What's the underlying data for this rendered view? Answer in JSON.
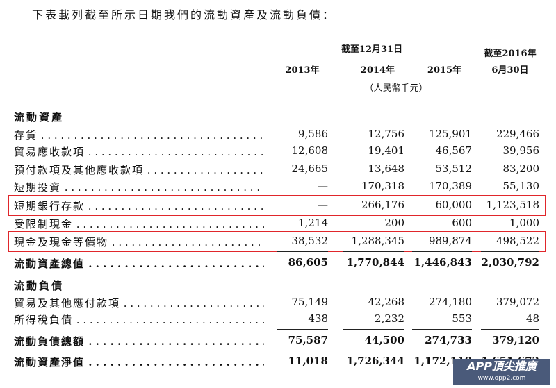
{
  "intro": "下表載列截至所示日期我們的流動資產及流動負債：",
  "headers": {
    "span_label": "截至12月31日",
    "y2013": "2013年",
    "y2014": "2014年",
    "y2015": "2015年",
    "last_line1": "截至2016年",
    "last_line2": "6月30日",
    "unit": "（人民幣千元）"
  },
  "sections": {
    "assets": "流動資產",
    "liabilities": "流動負債"
  },
  "rows": [
    {
      "label": "存貨",
      "v": [
        "9,586",
        "12,756",
        "125,901",
        "229,466"
      ]
    },
    {
      "label": "貿易應收款項",
      "v": [
        "12,608",
        "19,401",
        "46,567",
        "39,956"
      ]
    },
    {
      "label": "預付款項及其他應收款項",
      "v": [
        "24,665",
        "13,648",
        "53,512",
        "83,200"
      ]
    },
    {
      "label": "短期投資",
      "v": [
        "—",
        "170,318",
        "170,389",
        "55,130"
      ]
    },
    {
      "label": "短期銀行存款",
      "v": [
        "—",
        "266,176",
        "60,000",
        "1,123,518"
      ]
    },
    {
      "label": "受限制現金",
      "v": [
        "1,214",
        "200",
        "600",
        "1,000"
      ]
    },
    {
      "label": "現金及現金等價物",
      "v": [
        "38,532",
        "1,288,345",
        "989,874",
        "498,522"
      ]
    },
    {
      "label": "流動資產總值",
      "v": [
        "86,605",
        "1,770,844",
        "1,446,843",
        "2,030,792"
      ]
    },
    {
      "label": "貿易及其他應付款項",
      "v": [
        "75,149",
        "42,268",
        "274,180",
        "379,072"
      ]
    },
    {
      "label": "所得稅負債",
      "v": [
        "438",
        "2,232",
        "553",
        "48"
      ]
    },
    {
      "label": "流動負債總額",
      "v": [
        "75,587",
        "44,500",
        "274,733",
        "379,120"
      ]
    },
    {
      "label": "流動資產淨值",
      "v": [
        "11,018",
        "1,726,344",
        "1,172,110",
        "1,651,672"
      ]
    }
  ],
  "colors": {
    "highlight_box": "#e0262b"
  },
  "watermark": {
    "main": "APP頂尖推廣",
    "sub": "www.opp2.com"
  }
}
